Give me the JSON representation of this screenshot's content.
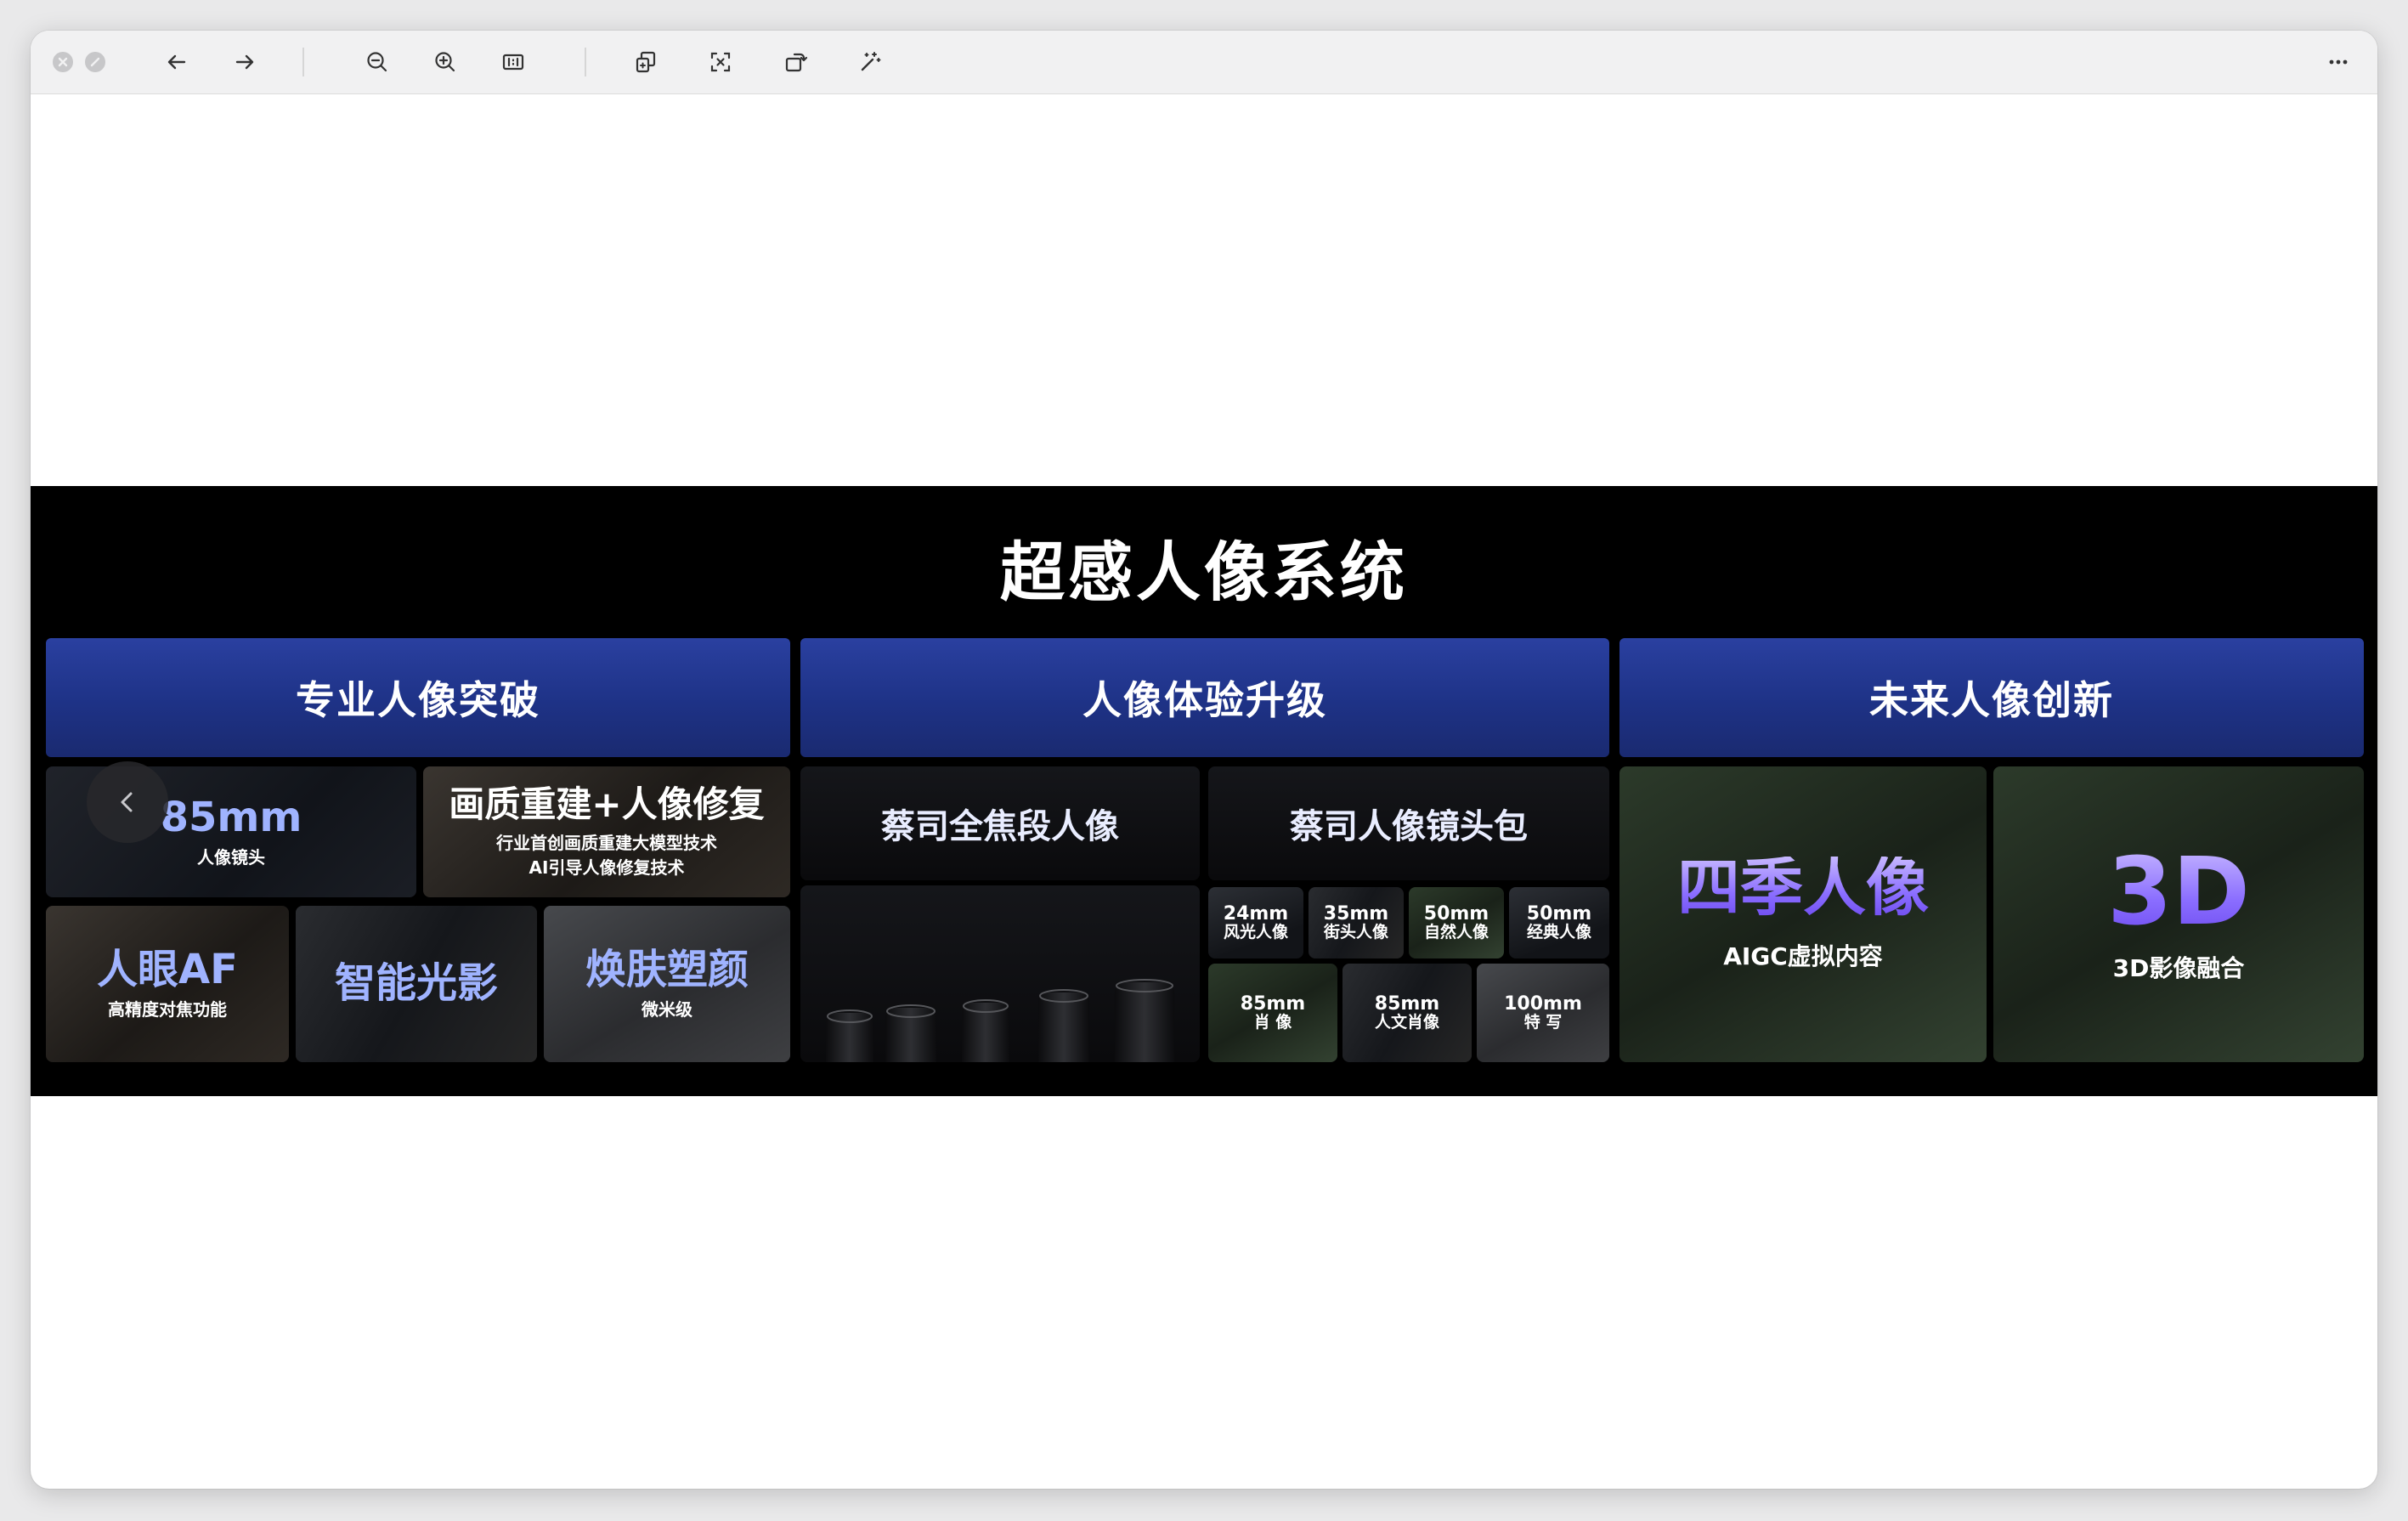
{
  "toolbar": {
    "buttons": [
      "close-icon",
      "minimize-icon",
      "back-arrow-icon",
      "forward-arrow-icon",
      "zoom-out-icon",
      "zoom-in-icon",
      "actual-size-icon",
      "copy-image-icon",
      "crop-icon",
      "rotate-icon",
      "magic-wand-icon",
      "more-icon"
    ]
  },
  "slide": {
    "title": "超感人像系统",
    "categories": [
      "专业人像突破",
      "人像体验升级",
      "未来人像创新"
    ],
    "tiles": {
      "lens85": {
        "title": "85mm",
        "sub": "人像镜头"
      },
      "restore": {
        "title": "画质重建+人像修复",
        "sub1": "行业首创画质重建大模型技术",
        "sub2": "AI引导人像修复技术"
      },
      "eyeaf": {
        "title": "人眼AF",
        "sub": "高精度对焦功能"
      },
      "light": {
        "title": "智能光影"
      },
      "skin": {
        "title": "焕肤塑颜",
        "sub": "微米级"
      },
      "zeiss_full": {
        "title": "蔡司全焦段人像"
      },
      "zeiss_pack": {
        "title": "蔡司人像镜头包"
      },
      "mini": [
        {
          "top": "24mm",
          "bot": "风光人像"
        },
        {
          "top": "35mm",
          "bot": "街头人像"
        },
        {
          "top": "50mm",
          "bot": "自然人像"
        },
        {
          "top": "50mm",
          "bot": "经典人像"
        },
        {
          "top": "85mm",
          "bot": "肖 像"
        },
        {
          "top": "85mm",
          "bot": "人文肖像"
        },
        {
          "top": "100mm",
          "bot": "特 写"
        }
      ],
      "seasons": {
        "title": "四季人像",
        "sub": "AIGC虚拟内容"
      },
      "threed": {
        "title": "3D",
        "sub": "3D影像融合"
      }
    }
  },
  "colors": {
    "header_blue": "#1e3286",
    "accent_purple": "#8a6dff"
  }
}
